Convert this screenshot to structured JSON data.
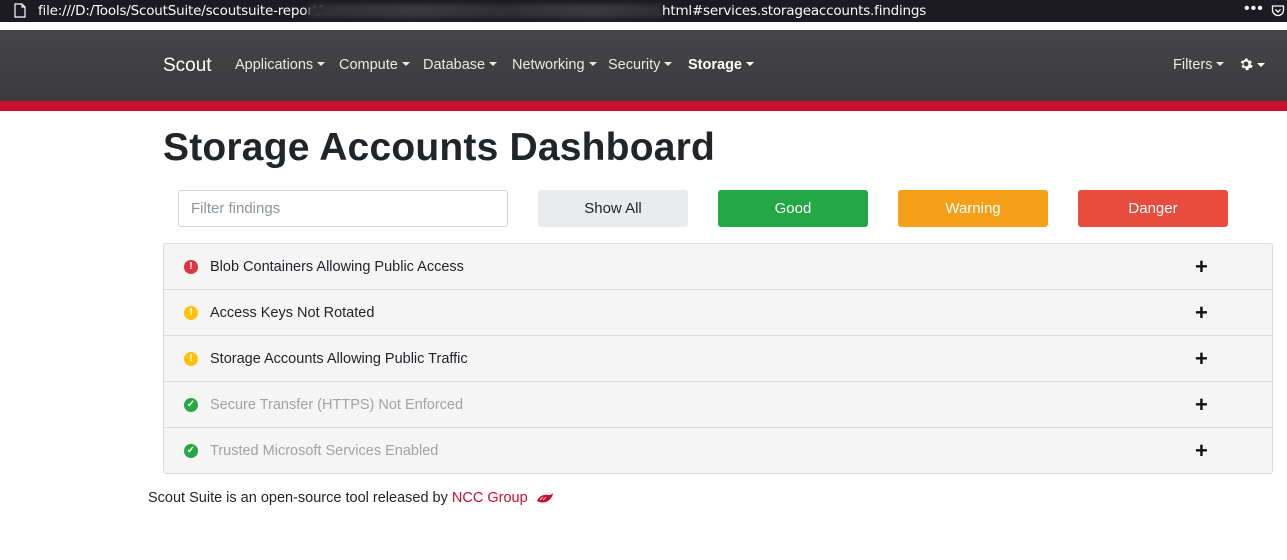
{
  "browser": {
    "url_left": "file:///D:/Tools/ScoutSuite/scoutsuite-report/a",
    "url_right": "html#services.storageaccounts.findings"
  },
  "navbar": {
    "brand": "Scout",
    "items": [
      {
        "label": "Applications"
      },
      {
        "label": "Compute"
      },
      {
        "label": "Database"
      },
      {
        "label": "Networking"
      },
      {
        "label": "Security"
      },
      {
        "label": "Storage"
      }
    ],
    "filters_label": "Filters"
  },
  "page": {
    "title": "Storage Accounts Dashboard",
    "filter_placeholder": "Filter findings",
    "buttons": {
      "all": "Show All",
      "good": "Good",
      "warning": "Warning",
      "danger": "Danger"
    }
  },
  "findings": [
    {
      "label": "Blob Containers Allowing Public Access",
      "status": "danger"
    },
    {
      "label": "Access Keys Not Rotated",
      "status": "warning"
    },
    {
      "label": "Storage Accounts Allowing Public Traffic",
      "status": "warning"
    },
    {
      "label": "Secure Transfer (HTTPS) Not Enforced",
      "status": "good"
    },
    {
      "label": "Trusted Microsoft Services Enabled",
      "status": "good"
    }
  ],
  "footer": {
    "text": "Scout Suite is an open-source tool released by ",
    "link": "NCC Group"
  },
  "colors": {
    "accent_stripe": "#c8102e",
    "good": "#24a845",
    "warning": "#f6a01a",
    "danger": "#e74c3c",
    "danger_icon": "#dc3545",
    "warning_icon": "#ffc107",
    "good_icon": "#28a745"
  }
}
